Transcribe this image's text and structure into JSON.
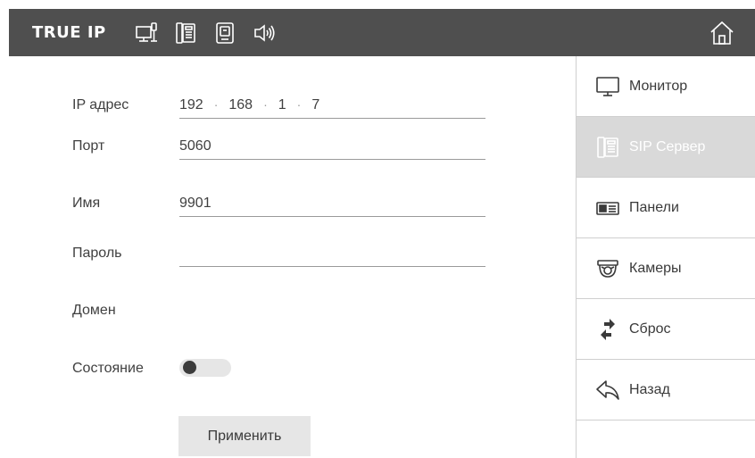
{
  "header": {
    "brand": "TRUE IP",
    "icons": [
      "network-settings-icon",
      "sip-phone-icon",
      "panel-icon",
      "sound-icon"
    ],
    "home_icon": "home-icon",
    "bg_color": "#4f4f4f"
  },
  "form": {
    "ip": {
      "label": "IP адрес",
      "parts": [
        "192",
        "168",
        "1",
        "7"
      ],
      "separator": "·"
    },
    "port": {
      "label": "Порт",
      "value": "5060"
    },
    "name": {
      "label": "Имя",
      "value": "9901"
    },
    "password": {
      "label": "Пароль",
      "value": ""
    },
    "domain": {
      "label": "Домен",
      "value": ""
    },
    "state": {
      "label": "Состояние",
      "enabled": false
    },
    "apply_label": "Применить"
  },
  "sidebar": {
    "items": [
      {
        "label": "Монитор",
        "icon": "monitor-icon",
        "active": false
      },
      {
        "label": "SIP Сервер",
        "icon": "sip-phone-icon",
        "active": true
      },
      {
        "label": "Панели",
        "icon": "door-panel-icon",
        "active": false
      },
      {
        "label": "Камеры",
        "icon": "camera-icon",
        "active": false
      },
      {
        "label": "Сброс",
        "icon": "reset-icon",
        "active": false
      },
      {
        "label": "Назад",
        "icon": "back-icon",
        "active": false
      }
    ]
  }
}
